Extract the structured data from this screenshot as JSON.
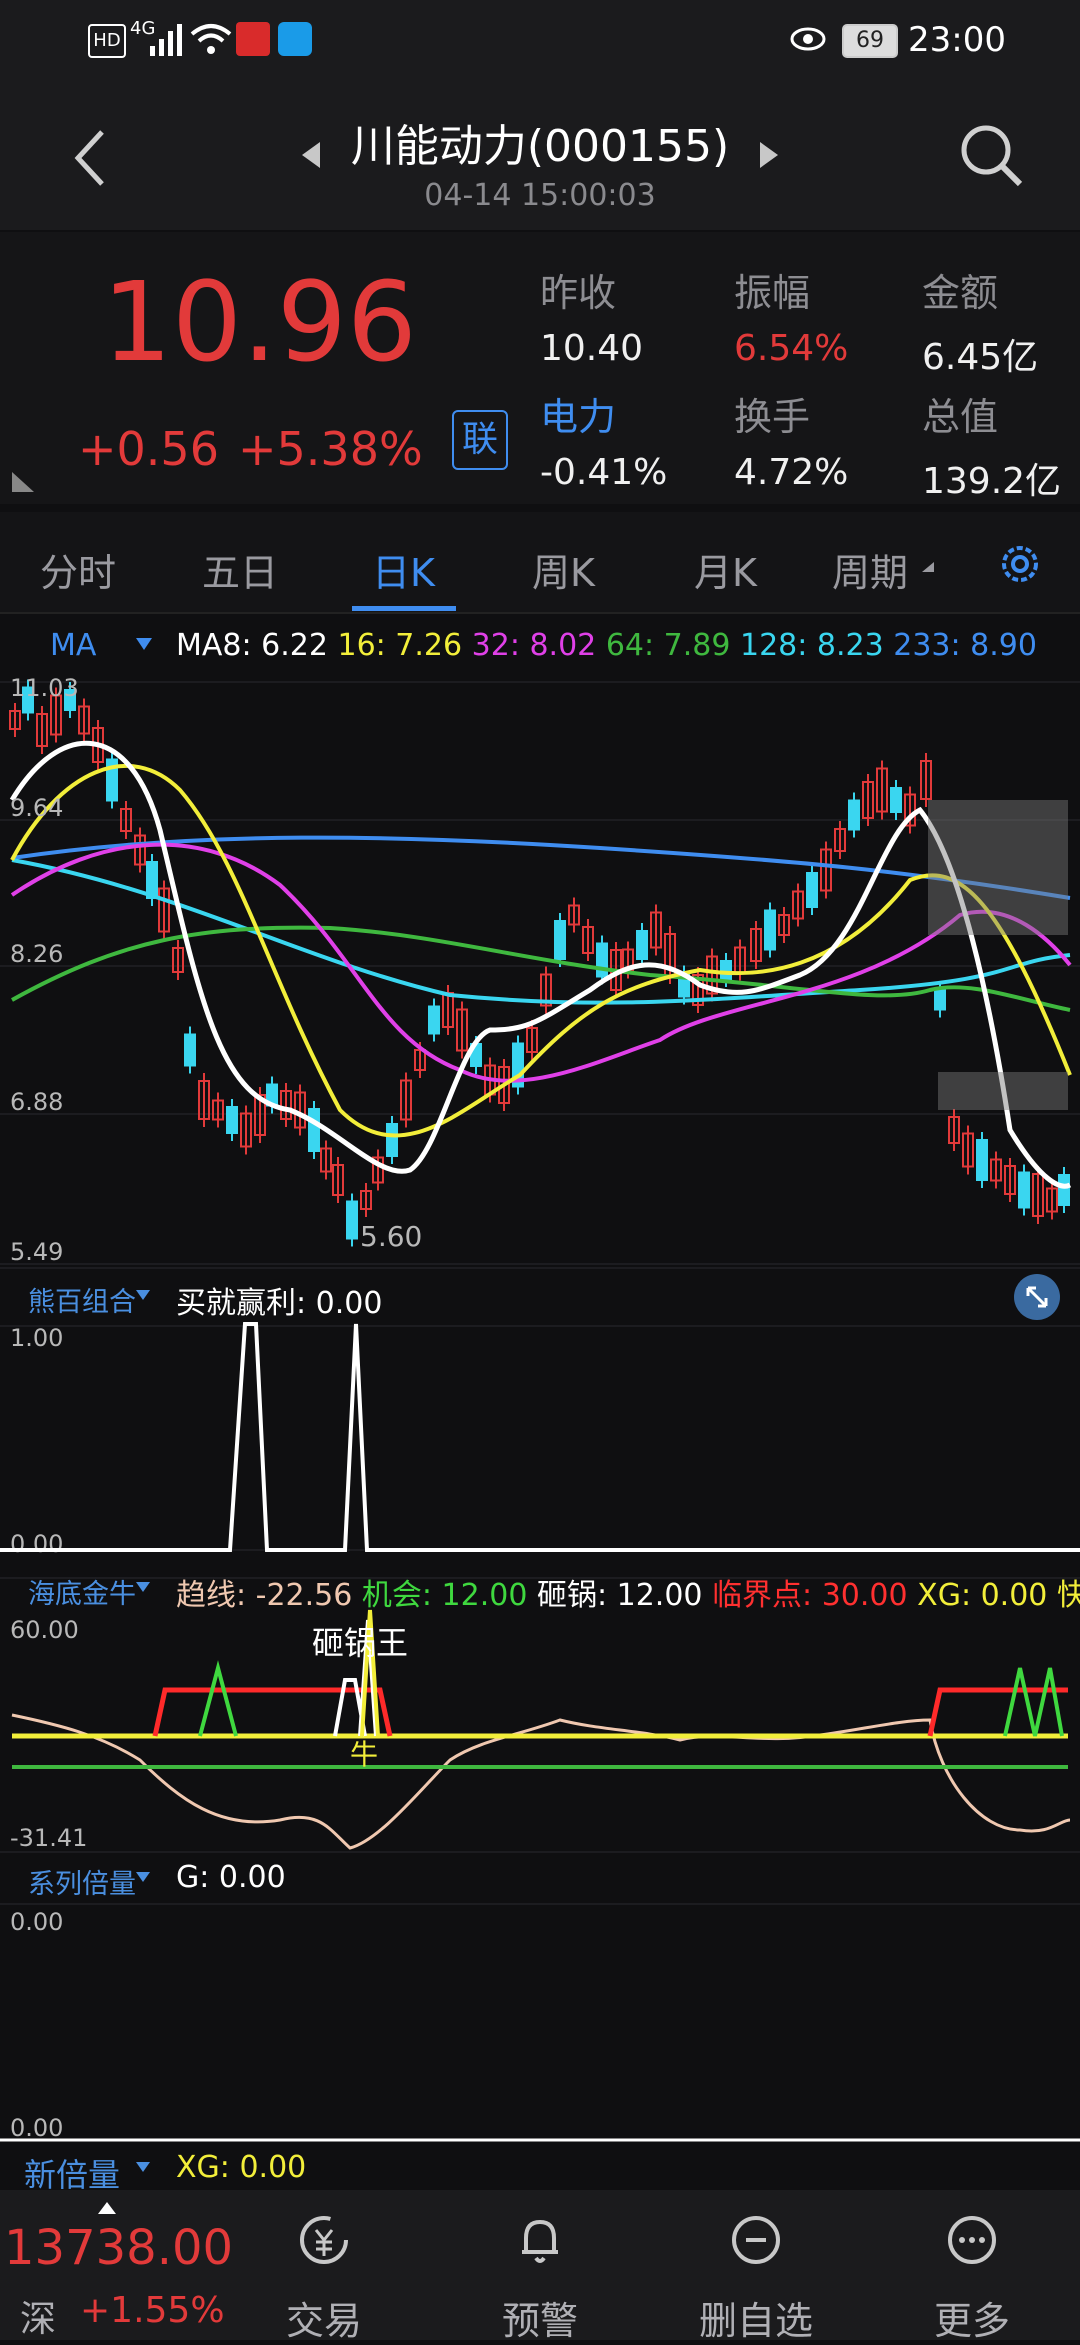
{
  "status": {
    "time": "23:00",
    "battery": "69",
    "network": "4G",
    "hd": "HD"
  },
  "header": {
    "title": "川能动力(000155)",
    "subtitle": "04-14 15:00:03"
  },
  "quote": {
    "price": "10.96",
    "change": "+0.56",
    "change_pct": "+5.38%",
    "link_badge": "联",
    "stats": [
      {
        "label": "昨收",
        "value": "10.40",
        "value_color": "#f0f0f0"
      },
      {
        "label": "振幅",
        "value": "6.54%",
        "value_color": "#e23a3a"
      },
      {
        "label": "金额",
        "value": "6.45亿",
        "value_color": "#f0f0f0"
      },
      {
        "label": "电力",
        "value": "-0.41%",
        "value_color": "#f0f0f0"
      },
      {
        "label": "换手",
        "value": "4.72%",
        "value_color": "#f0f0f0"
      },
      {
        "label": "总值",
        "value": "139.2亿",
        "value_color": "#f0f0f0"
      }
    ]
  },
  "tabs": [
    "分时",
    "五日",
    "日K",
    "周K",
    "月K",
    "周期"
  ],
  "active_tab": "日K",
  "ma_legend": {
    "label": "MA",
    "items": [
      {
        "text": "MA8: 6.22",
        "color": "#ffffff"
      },
      {
        "text": "16: 7.26",
        "color": "#f2ee3a"
      },
      {
        "text": "32: 8.02",
        "color": "#e040e8"
      },
      {
        "text": "64: 7.89",
        "color": "#3fb83f"
      },
      {
        "text": "128: 8.23",
        "color": "#3ad6f0"
      },
      {
        "text": "233: 8.90",
        "color": "#3f8df0"
      }
    ]
  },
  "chart_data": {
    "type": "candlestick",
    "y_ticks": [
      "11.03",
      "9.64",
      "8.26",
      "6.88",
      "5.49"
    ],
    "ylim": [
      5.49,
      11.03
    ],
    "low_annotation": "5.60",
    "high": 11.03
  },
  "panel_xiongbai": {
    "label": "熊百组合",
    "value_text": "买就赢利: 0.00",
    "y_ticks": [
      "1.00",
      "0.00"
    ]
  },
  "panel_haidi": {
    "label": "海底金牛",
    "items": [
      {
        "text": "趋线: -22.56",
        "color": "#f0c8b0"
      },
      {
        "text": "机会: 12.00",
        "color": "#3fd83f"
      },
      {
        "text": "砸锅: 12.00",
        "color": "#ffffff"
      },
      {
        "text": "临界点: 30.00",
        "color": "#ff3030"
      },
      {
        "text": "XG: 0.00",
        "color": "#f2ee3a"
      },
      {
        "text": "快",
        "color": "#f2ee3a"
      }
    ],
    "y_ticks": [
      "60.00",
      "-31.41"
    ],
    "annotation_a": "砸锅王",
    "annotation_b": "牛"
  },
  "panel_xilie": {
    "label": "系列倍量",
    "value_text": "G: 0.00",
    "y_ticks": [
      "0.00",
      "0.00"
    ]
  },
  "panel_xin": {
    "label": "新倍量",
    "value_text": "XG: 0.00"
  },
  "bottom": {
    "index_value": "13738.00",
    "index_name": "深",
    "index_change": "+1.55%",
    "actions": [
      "交易",
      "预警",
      "删自选",
      "更多"
    ]
  }
}
